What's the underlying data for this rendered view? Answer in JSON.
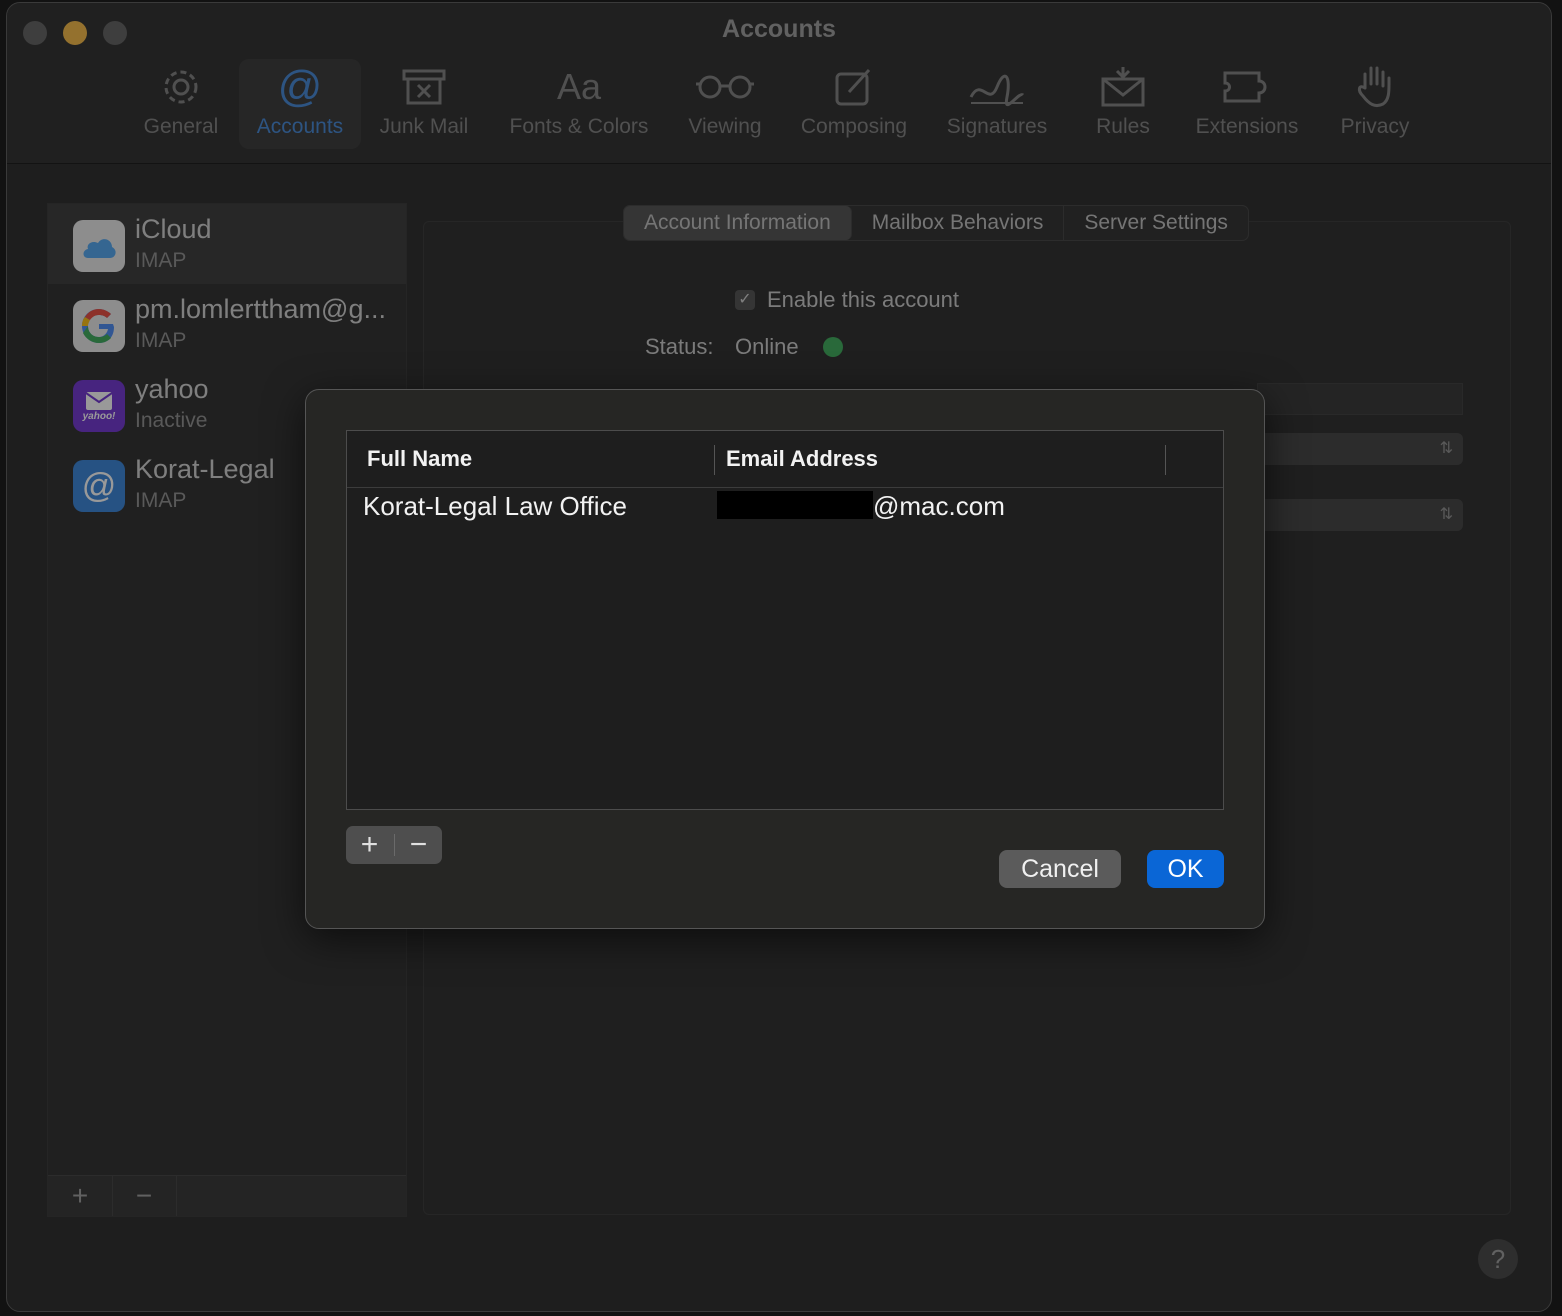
{
  "window": {
    "title": "Accounts"
  },
  "toolbar": {
    "items": [
      {
        "label": "General",
        "icon": "gear-icon"
      },
      {
        "label": "Accounts",
        "icon": "at-icon"
      },
      {
        "label": "Junk Mail",
        "icon": "junk-tray-icon"
      },
      {
        "label": "Fonts & Colors",
        "icon": "font-icon",
        "glyph": "Aa"
      },
      {
        "label": "Viewing",
        "icon": "glasses-icon"
      },
      {
        "label": "Composing",
        "icon": "compose-icon"
      },
      {
        "label": "Signatures",
        "icon": "signature-icon"
      },
      {
        "label": "Rules",
        "icon": "rules-envelope-icon"
      },
      {
        "label": "Extensions",
        "icon": "puzzle-icon"
      },
      {
        "label": "Privacy",
        "icon": "hand-icon"
      }
    ],
    "active": "Accounts",
    "accent_color": "#3b82d6"
  },
  "sidebar": {
    "accounts": [
      {
        "name": "iCloud",
        "type": "IMAP",
        "icon": "icloud-icon",
        "selected": true
      },
      {
        "name": "pm.lomlerttham@g...",
        "type": "IMAP",
        "icon": "google-icon"
      },
      {
        "name": "yahoo",
        "type": "Inactive",
        "icon": "yahoo-mail-icon",
        "icon_text": "yahoo!"
      },
      {
        "name": "Korat-Legal",
        "type": "IMAP",
        "icon": "at-mail-icon"
      }
    ],
    "add_label": "+",
    "remove_label": "−"
  },
  "detail": {
    "tabs": [
      "Account Information",
      "Mailbox Behaviors",
      "Server Settings"
    ],
    "active_tab": "Account Information",
    "enable_label": "Enable this account",
    "enabled": true,
    "status_label": "Status:",
    "status_value": "Online",
    "status_color": "#34a853"
  },
  "sheet": {
    "columns": [
      "Full Name",
      "Email Address"
    ],
    "rows": [
      {
        "full_name": "Korat-Legal Law Office",
        "email_suffix": "@mac.com",
        "email_redacted": true
      }
    ],
    "add_label": "+",
    "remove_label": "−",
    "cancel_label": "Cancel",
    "ok_label": "OK",
    "ok_color": "#0a66d6"
  },
  "help_label": "?"
}
